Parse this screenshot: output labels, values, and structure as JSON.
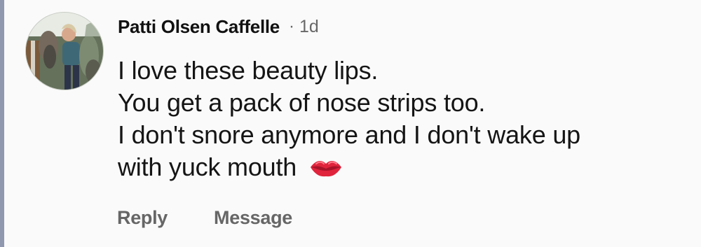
{
  "comment": {
    "author": "Patti Olsen Caffelle",
    "separator": "·",
    "timestamp": "1d",
    "avatar_icon": "profile-photo",
    "text_lines": [
      "I love these beauty lips.",
      "You get a pack of nose strips too.",
      "I don't snore anymore and I don't wake up",
      "with yuck mouth"
    ],
    "emoji_icon": "lips-emoji",
    "actions": {
      "reply_label": "Reply",
      "message_label": "Message"
    }
  },
  "colors": {
    "background": "#fafafa",
    "text": "#151515",
    "muted": "#666666",
    "left_rule": "#8f98ae",
    "emoji_red": "#e0243c"
  }
}
